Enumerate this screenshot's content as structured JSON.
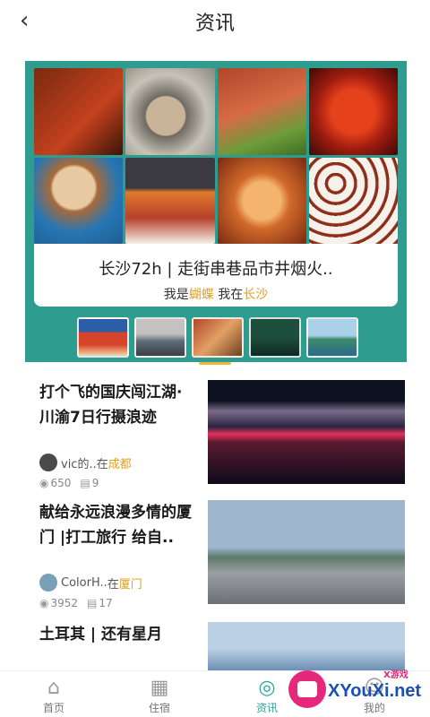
{
  "header": {
    "back_icon": "chevron-left-icon",
    "title": "资讯"
  },
  "banner": {
    "title": "长沙72h | 走街串巷品市井烟火..",
    "sub_prefix": "我是",
    "sub_author": "蝴蝶",
    "sub_mid": " 我在",
    "sub_city": "长沙",
    "thumb_count": 5,
    "active_thumb": 3
  },
  "articles": [
    {
      "title": "打个飞的国庆闯江湖·川渝7日行摄浪迹",
      "author": "vic的..",
      "in": " 在",
      "city": "成都",
      "views": "650",
      "comments": "9"
    },
    {
      "title": "献给永远浪漫多情的厦门 |打工旅行 给自..",
      "author": "ColorH..",
      "in": " 在",
      "city": "厦门",
      "views": "3952",
      "comments": "17"
    },
    {
      "title": "土耳其 | 还有星月"
    }
  ],
  "tabbar": [
    {
      "label": "首页",
      "icon": "home-icon"
    },
    {
      "label": "住宿",
      "icon": "building-icon"
    },
    {
      "label": "资讯",
      "icon": "compass-icon",
      "active": true
    },
    {
      "label": "我的",
      "icon": "user-icon"
    }
  ],
  "watermark": {
    "small": "X游戏",
    "site": "XYouXi.net"
  },
  "colors": {
    "accent": "#2aa7a0",
    "highlight": "#e0a020",
    "banner_bg": "#2e9c8e"
  }
}
